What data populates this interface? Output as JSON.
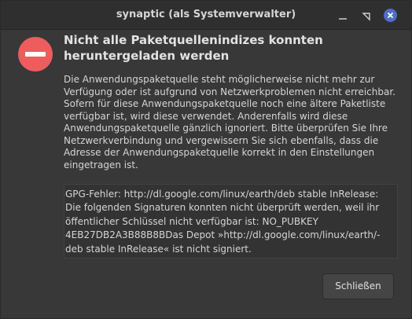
{
  "window": {
    "title": "synaptic (als Systemverwalter)"
  },
  "dialog": {
    "icon": "error-icon",
    "headline": "Nicht alle Paketquellenindizes konnten heruntergeladen werden",
    "message": "Die Anwendungspaketquelle steht möglicherweise nicht mehr zur Verfügung oder ist aufgrund von Netzwerkproblemen nicht erreichbar. Sofern für diese Anwendungspaketquelle noch eine ältere Paketliste verfügbar ist, wird diese verwendet. Anderenfalls wird diese Anwendungspaketquelle gänzlich ignoriert. Bitte überprüfen Sie Ihre Netzwerkverbindung und vergewissern Sie sich ebenfalls, dass die Adresse der Anwendungspaketquelle korrekt in den Einstellungen eingetragen ist.",
    "details": "GPG-Fehler: http://dl.google.com/linux/earth/deb stable InRelease: Die folgenden Signaturen konnten nicht überprüft werden, weil ihr öffentlicher Schlüssel nicht verfügbar ist: NO_PUBKEY 4EB27DB2A3B88B8BDas Depot »http://dl.google.com/linux/earth/-deb stable InRelease« ist nicht signiert.",
    "close_label": "Schließen"
  },
  "colors": {
    "window_bg": "#383838",
    "titlebar_bg": "#2f2f2f",
    "error_red": "#ee5d5e",
    "close_blue": "#4f6fc4"
  }
}
